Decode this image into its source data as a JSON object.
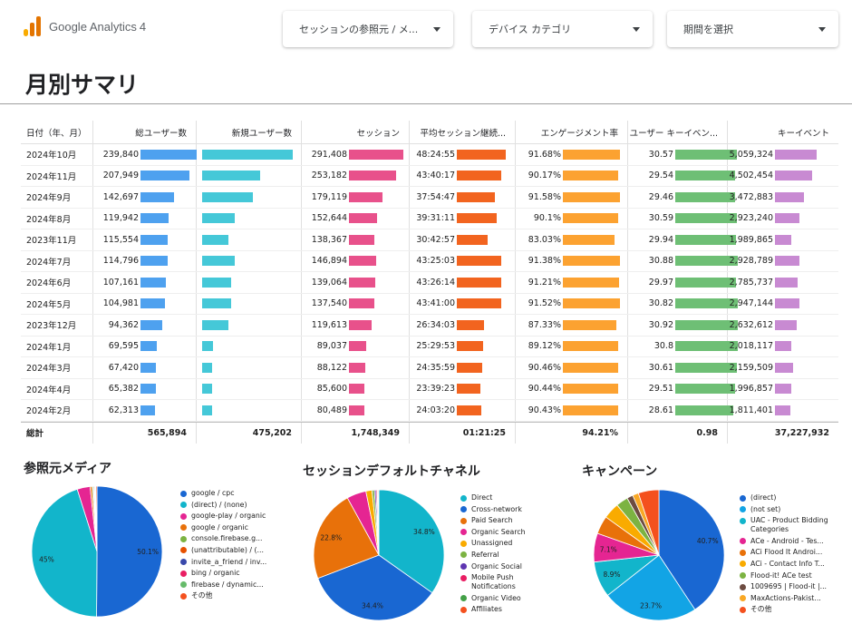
{
  "header": {
    "brand": "Google Analytics",
    "brand_version": "4",
    "dropdowns": [
      "セッションの参照元 / メ...",
      "デバイス カテゴリ",
      "期間を選択"
    ]
  },
  "page_title": "月別サマリ",
  "table": {
    "headers": [
      "日付（年、月）",
      "総ユーザー数",
      "新規ユーザー数",
      "セッション",
      "平均セッション継続...",
      "エンゲージメント率",
      "ユーザー キーイベン...",
      "キーイベント"
    ],
    "rows": [
      [
        "2024年10月",
        "239,840",
        "",
        "291,408",
        "48:24:55",
        "91.68%",
        "30.57",
        "5,059,324"
      ],
      [
        "2024年11月",
        "207,949",
        "",
        "253,182",
        "43:40:17",
        "90.17%",
        "29.54",
        "4,502,454"
      ],
      [
        "2024年9月",
        "142,697",
        "",
        "179,119",
        "37:54:47",
        "91.58%",
        "29.46",
        "3,472,883"
      ],
      [
        "2024年8月",
        "119,942",
        "",
        "152,644",
        "39:31:11",
        "90.1%",
        "30.59",
        "2,923,240"
      ],
      [
        "2023年11月",
        "115,554",
        "",
        "138,367",
        "30:42:57",
        "83.03%",
        "29.94",
        "1,989,865"
      ],
      [
        "2024年7月",
        "114,796",
        "",
        "146,894",
        "43:25:03",
        "91.38%",
        "30.88",
        "2,928,789"
      ],
      [
        "2024年6月",
        "107,161",
        "",
        "139,064",
        "43:26:14",
        "91.21%",
        "29.97",
        "2,785,737"
      ],
      [
        "2024年5月",
        "104,981",
        "",
        "137,540",
        "43:41:00",
        "91.52%",
        "30.82",
        "2,947,144"
      ],
      [
        "2023年12月",
        "94,362",
        "",
        "119,613",
        "26:34:03",
        "87.33%",
        "30.92",
        "2,632,612"
      ],
      [
        "2024年1月",
        "69,595",
        "",
        "89,037",
        "25:29:53",
        "89.12%",
        "30.8",
        "2,018,117"
      ],
      [
        "2024年3月",
        "67,420",
        "",
        "88,122",
        "24:35:59",
        "90.46%",
        "30.61",
        "2,159,509"
      ],
      [
        "2024年4月",
        "65,382",
        "",
        "85,600",
        "23:39:23",
        "90.44%",
        "29.51",
        "1,996,857"
      ],
      [
        "2024年2月",
        "62,313",
        "",
        "80,489",
        "24:03:20",
        "90.43%",
        "28.61",
        "1,811,401"
      ]
    ],
    "bar_fractions": [
      [
        1.0,
        1.0,
        1.0,
        1.0,
        0.95,
        0.95,
        1.0
      ],
      [
        0.87,
        0.64,
        0.87,
        0.9,
        0.93,
        0.92,
        0.89
      ],
      [
        0.6,
        0.56,
        0.61,
        0.78,
        0.95,
        0.91,
        0.69
      ],
      [
        0.5,
        0.36,
        0.52,
        0.82,
        0.93,
        0.95,
        0.58
      ],
      [
        0.48,
        0.29,
        0.47,
        0.63,
        0.86,
        0.93,
        0.39
      ],
      [
        0.48,
        0.36,
        0.5,
        0.9,
        0.95,
        0.96,
        0.58
      ],
      [
        0.45,
        0.32,
        0.48,
        0.9,
        0.94,
        0.93,
        0.55
      ],
      [
        0.44,
        0.32,
        0.47,
        0.9,
        0.95,
        0.96,
        0.58
      ],
      [
        0.39,
        0.29,
        0.41,
        0.55,
        0.9,
        0.96,
        0.52
      ],
      [
        0.29,
        0.12,
        0.31,
        0.53,
        0.92,
        0.96,
        0.4
      ],
      [
        0.28,
        0.11,
        0.3,
        0.51,
        0.93,
        0.95,
        0.43
      ],
      [
        0.27,
        0.11,
        0.29,
        0.49,
        0.93,
        0.92,
        0.39
      ],
      [
        0.26,
        0.11,
        0.28,
        0.5,
        0.93,
        0.89,
        0.36
      ]
    ],
    "bar_colors": [
      "#4ea1ef",
      "#45c8d8",
      "#e8518b",
      "#f2641f",
      "#fca231",
      "#6ebf75",
      "#c88ad2"
    ],
    "totals": [
      "総計",
      "565,894",
      "475,202",
      "1,748,349",
      "01:21:25",
      "94.21%",
      "0.98",
      "37,227,932"
    ]
  },
  "chart_data": [
    {
      "type": "pie",
      "title": "参照元メディア",
      "labels": [
        "google / cpc",
        "(direct) / (none)",
        "google-play / organic",
        "google / organic",
        "console.firebase.g...",
        "(unattributable) / (...",
        "invite_a_friend / inv...",
        "bing / organic",
        "firebase / dynamic...",
        "その他"
      ],
      "values": [
        50.1,
        45,
        3.2,
        0.5,
        0.3,
        0.2,
        0.2,
        0.1,
        0.1,
        0.3
      ],
      "slice_labels": [
        "50.1%",
        "45%",
        "",
        "",
        "",
        "",
        "",
        "",
        "",
        ""
      ],
      "colors": [
        "#1967d2",
        "#12b5cb",
        "#e52592",
        "#e8710a",
        "#7cb342",
        "#e65100",
        "#3949ab",
        "#e91e63",
        "#66bb6a",
        "#f4511e"
      ]
    },
    {
      "type": "pie",
      "title": "セッションデフォルトチャネル",
      "labels": [
        "Direct",
        "Cross-network",
        "Paid Search",
        "Organic Search",
        "Unassigned",
        "Referral",
        "Organic Social",
        "Mobile Push Notifications",
        "Organic Video",
        "Affiliates"
      ],
      "values": [
        34.8,
        34.4,
        22.8,
        4.8,
        1.5,
        0.6,
        0.4,
        0.3,
        0.2,
        0.2
      ],
      "slice_labels": [
        "34.8%",
        "34.4%",
        "22.8%",
        "",
        "",
        "",
        "",
        "",
        "",
        ""
      ],
      "colors": [
        "#12b5cb",
        "#1967d2",
        "#e8710a",
        "#e52592",
        "#f9ab00",
        "#7cb342",
        "#5e35b1",
        "#e91e63",
        "#43a047",
        "#f4511e"
      ]
    },
    {
      "type": "pie",
      "title": "キャンペーン",
      "labels": [
        "(direct)",
        "(not set)",
        "UAC - Product Bidding Categories",
        "ACe - Android - Tes...",
        "ACi Flood It Androi...",
        "ACi - Contact Info T...",
        "Flood-it! ACe test",
        "1009695 | Flood-it |...",
        "MaxActions-Pakist...",
        "その他"
      ],
      "values": [
        40.7,
        23.7,
        8.9,
        7.1,
        4.5,
        4.0,
        3.0,
        1.5,
        1.5,
        5.1
      ],
      "slice_labels": [
        "40.7%",
        "23.7%",
        "8.9%",
        "7.1%",
        "",
        "",
        "",
        "",
        "",
        ""
      ],
      "colors": [
        "#1967d2",
        "#12a4e5",
        "#12b5cb",
        "#e52592",
        "#e8710a",
        "#f9ab00",
        "#7cb342",
        "#6d4c41",
        "#f9a825",
        "#f4511e"
      ]
    }
  ]
}
